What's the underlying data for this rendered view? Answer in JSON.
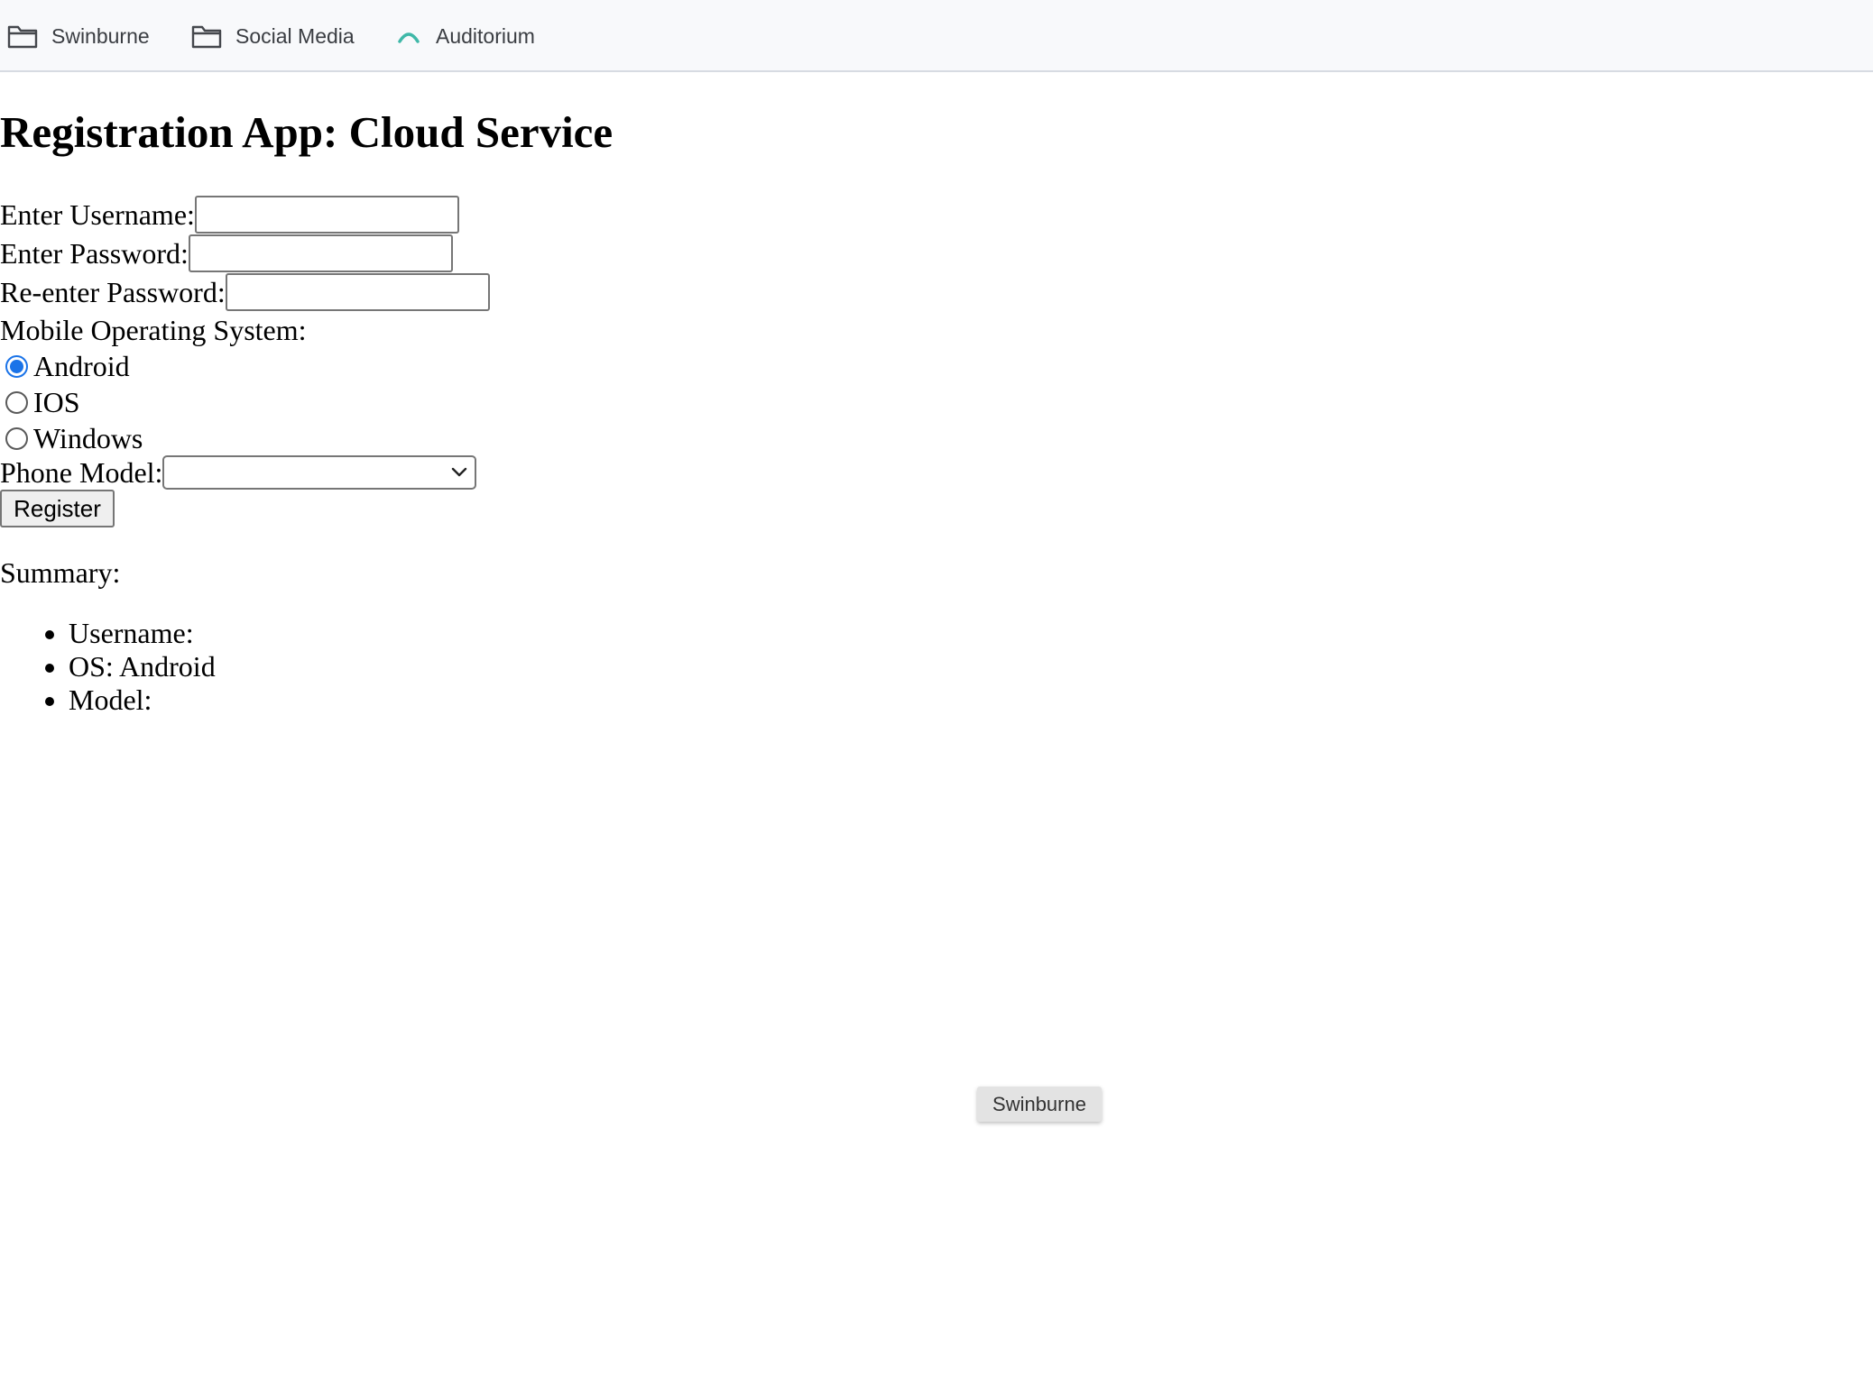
{
  "bookmarks": [
    {
      "label": "Swinburne",
      "icon": "folder-icon"
    },
    {
      "label": "Social Media",
      "icon": "folder-icon"
    },
    {
      "label": "Auditorium",
      "icon": "arc-logo-icon"
    }
  ],
  "colors": {
    "bookmark_bar_bg": "#f8f9fb",
    "radio_checked": "#1a73e8",
    "auditorium_icon": "#3fb8a8",
    "button_bg": "#efefef"
  },
  "page": {
    "title": "Registration App: Cloud Service"
  },
  "form": {
    "username_label": "Enter Username:",
    "username_value": "",
    "password_label": "Enter Password:",
    "password_value": "",
    "reenter_label": "Re-enter Password:",
    "reenter_value": "",
    "os_label": "Mobile Operating System:",
    "os_options": [
      {
        "label": "Android",
        "checked": true
      },
      {
        "label": "IOS",
        "checked": false
      },
      {
        "label": "Windows",
        "checked": false
      }
    ],
    "model_label": "Phone Model:",
    "model_selected": "",
    "register_label": "Register"
  },
  "summary": {
    "label": "Summary:",
    "items": [
      "Username:",
      "OS: Android",
      "Model:"
    ]
  },
  "tooltip": {
    "text": "Swinburne"
  }
}
